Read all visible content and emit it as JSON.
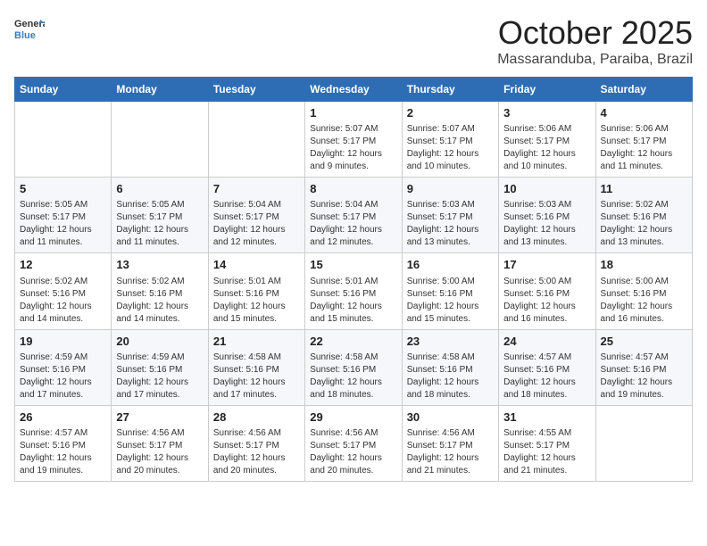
{
  "header": {
    "logo_general": "General",
    "logo_blue": "Blue",
    "month": "October 2025",
    "location": "Massaranduba, Paraiba, Brazil"
  },
  "weekdays": [
    "Sunday",
    "Monday",
    "Tuesday",
    "Wednesday",
    "Thursday",
    "Friday",
    "Saturday"
  ],
  "weeks": [
    [
      {
        "day": "",
        "info": ""
      },
      {
        "day": "",
        "info": ""
      },
      {
        "day": "",
        "info": ""
      },
      {
        "day": "1",
        "info": "Sunrise: 5:07 AM\nSunset: 5:17 PM\nDaylight: 12 hours\nand 9 minutes."
      },
      {
        "day": "2",
        "info": "Sunrise: 5:07 AM\nSunset: 5:17 PM\nDaylight: 12 hours\nand 10 minutes."
      },
      {
        "day": "3",
        "info": "Sunrise: 5:06 AM\nSunset: 5:17 PM\nDaylight: 12 hours\nand 10 minutes."
      },
      {
        "day": "4",
        "info": "Sunrise: 5:06 AM\nSunset: 5:17 PM\nDaylight: 12 hours\nand 11 minutes."
      }
    ],
    [
      {
        "day": "5",
        "info": "Sunrise: 5:05 AM\nSunset: 5:17 PM\nDaylight: 12 hours\nand 11 minutes."
      },
      {
        "day": "6",
        "info": "Sunrise: 5:05 AM\nSunset: 5:17 PM\nDaylight: 12 hours\nand 11 minutes."
      },
      {
        "day": "7",
        "info": "Sunrise: 5:04 AM\nSunset: 5:17 PM\nDaylight: 12 hours\nand 12 minutes."
      },
      {
        "day": "8",
        "info": "Sunrise: 5:04 AM\nSunset: 5:17 PM\nDaylight: 12 hours\nand 12 minutes."
      },
      {
        "day": "9",
        "info": "Sunrise: 5:03 AM\nSunset: 5:17 PM\nDaylight: 12 hours\nand 13 minutes."
      },
      {
        "day": "10",
        "info": "Sunrise: 5:03 AM\nSunset: 5:16 PM\nDaylight: 12 hours\nand 13 minutes."
      },
      {
        "day": "11",
        "info": "Sunrise: 5:02 AM\nSunset: 5:16 PM\nDaylight: 12 hours\nand 13 minutes."
      }
    ],
    [
      {
        "day": "12",
        "info": "Sunrise: 5:02 AM\nSunset: 5:16 PM\nDaylight: 12 hours\nand 14 minutes."
      },
      {
        "day": "13",
        "info": "Sunrise: 5:02 AM\nSunset: 5:16 PM\nDaylight: 12 hours\nand 14 minutes."
      },
      {
        "day": "14",
        "info": "Sunrise: 5:01 AM\nSunset: 5:16 PM\nDaylight: 12 hours\nand 15 minutes."
      },
      {
        "day": "15",
        "info": "Sunrise: 5:01 AM\nSunset: 5:16 PM\nDaylight: 12 hours\nand 15 minutes."
      },
      {
        "day": "16",
        "info": "Sunrise: 5:00 AM\nSunset: 5:16 PM\nDaylight: 12 hours\nand 15 minutes."
      },
      {
        "day": "17",
        "info": "Sunrise: 5:00 AM\nSunset: 5:16 PM\nDaylight: 12 hours\nand 16 minutes."
      },
      {
        "day": "18",
        "info": "Sunrise: 5:00 AM\nSunset: 5:16 PM\nDaylight: 12 hours\nand 16 minutes."
      }
    ],
    [
      {
        "day": "19",
        "info": "Sunrise: 4:59 AM\nSunset: 5:16 PM\nDaylight: 12 hours\nand 17 minutes."
      },
      {
        "day": "20",
        "info": "Sunrise: 4:59 AM\nSunset: 5:16 PM\nDaylight: 12 hours\nand 17 minutes."
      },
      {
        "day": "21",
        "info": "Sunrise: 4:58 AM\nSunset: 5:16 PM\nDaylight: 12 hours\nand 17 minutes."
      },
      {
        "day": "22",
        "info": "Sunrise: 4:58 AM\nSunset: 5:16 PM\nDaylight: 12 hours\nand 18 minutes."
      },
      {
        "day": "23",
        "info": "Sunrise: 4:58 AM\nSunset: 5:16 PM\nDaylight: 12 hours\nand 18 minutes."
      },
      {
        "day": "24",
        "info": "Sunrise: 4:57 AM\nSunset: 5:16 PM\nDaylight: 12 hours\nand 18 minutes."
      },
      {
        "day": "25",
        "info": "Sunrise: 4:57 AM\nSunset: 5:16 PM\nDaylight: 12 hours\nand 19 minutes."
      }
    ],
    [
      {
        "day": "26",
        "info": "Sunrise: 4:57 AM\nSunset: 5:16 PM\nDaylight: 12 hours\nand 19 minutes."
      },
      {
        "day": "27",
        "info": "Sunrise: 4:56 AM\nSunset: 5:17 PM\nDaylight: 12 hours\nand 20 minutes."
      },
      {
        "day": "28",
        "info": "Sunrise: 4:56 AM\nSunset: 5:17 PM\nDaylight: 12 hours\nand 20 minutes."
      },
      {
        "day": "29",
        "info": "Sunrise: 4:56 AM\nSunset: 5:17 PM\nDaylight: 12 hours\nand 20 minutes."
      },
      {
        "day": "30",
        "info": "Sunrise: 4:56 AM\nSunset: 5:17 PM\nDaylight: 12 hours\nand 21 minutes."
      },
      {
        "day": "31",
        "info": "Sunrise: 4:55 AM\nSunset: 5:17 PM\nDaylight: 12 hours\nand 21 minutes."
      },
      {
        "day": "",
        "info": ""
      }
    ]
  ]
}
